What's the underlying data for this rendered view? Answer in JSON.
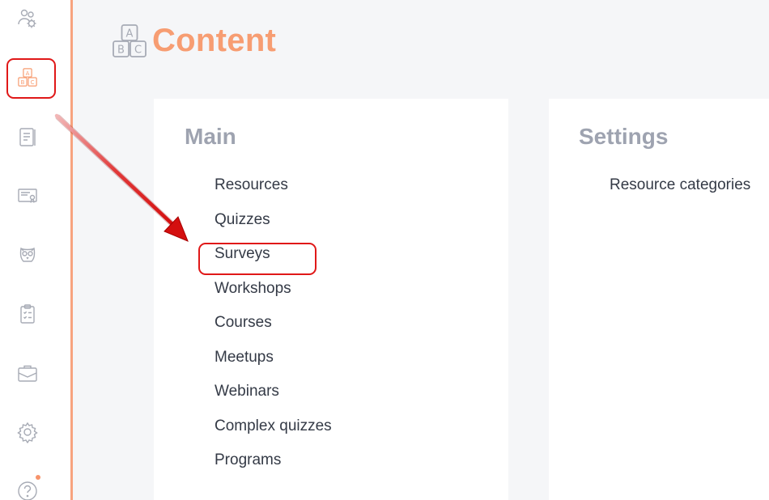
{
  "app": {
    "title": "Content",
    "title_icon": "abc-blocks-icon",
    "accent_color": "#f79d72",
    "highlight_color": "#e01818"
  },
  "sidebar": {
    "items": [
      {
        "icon": "users-gear-icon",
        "active": false
      },
      {
        "icon": "abc-blocks-icon",
        "active": true
      },
      {
        "icon": "notebook-icon",
        "active": false
      },
      {
        "icon": "certificate-icon",
        "active": false
      },
      {
        "icon": "owl-icon",
        "active": false
      },
      {
        "icon": "clipboard-icon",
        "active": false
      },
      {
        "icon": "briefcase-icon",
        "active": false
      },
      {
        "icon": "gear-icon",
        "active": false
      },
      {
        "icon": "help-icon",
        "active": false,
        "notification": true
      }
    ]
  },
  "main": {
    "heading": "Main",
    "links": [
      "Resources",
      "Quizzes",
      "Surveys",
      "Workshops",
      "Courses",
      "Meetups",
      "Webinars",
      "Complex quizzes",
      "Programs"
    ],
    "highlighted": "Surveys"
  },
  "settings": {
    "heading": "Settings",
    "links": [
      "Resource categories"
    ]
  }
}
